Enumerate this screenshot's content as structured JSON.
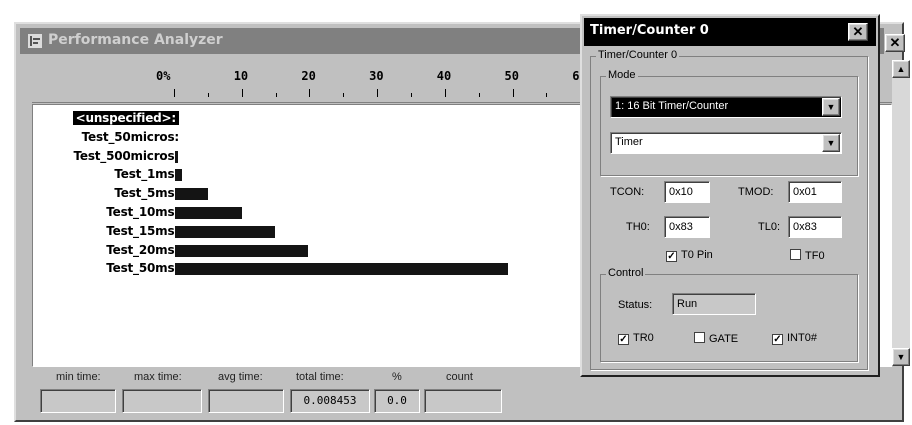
{
  "analyzer": {
    "title": "Performance Analyzer",
    "scale_ticks": [
      "0%",
      "10",
      "20",
      "30",
      "40",
      "50",
      "6"
    ],
    "rows": [
      {
        "label": "<unspecified>:",
        "percent": 0,
        "selected": true
      },
      {
        "label": "Test_50micros:",
        "percent": 0,
        "selected": false
      },
      {
        "label": "Test_500micros:",
        "percent": 0.5,
        "selected": false
      },
      {
        "label": "Test_1ms:",
        "percent": 1,
        "selected": false
      },
      {
        "label": "Test_5ms:",
        "percent": 5,
        "selected": false
      },
      {
        "label": "Test_10ms:",
        "percent": 10,
        "selected": false
      },
      {
        "label": "Test_15ms:",
        "percent": 15,
        "selected": false
      },
      {
        "label": "Test_20ms:",
        "percent": 20,
        "selected": false
      },
      {
        "label": "Test_50ms:",
        "percent": 50,
        "selected": false
      }
    ],
    "stats": {
      "min_time_label": "min time:",
      "max_time_label": "max time:",
      "avg_time_label": "avg time:",
      "total_time_label": "total time:",
      "percent_label": "%",
      "count_label": "count",
      "min_time": "",
      "max_time": "",
      "avg_time": "",
      "total_time": "0.008453",
      "percent": "0.0",
      "count": ""
    }
  },
  "timer_dialog": {
    "title": "Timer/Counter 0",
    "group_label": "Timer/Counter 0",
    "mode_label": "Mode",
    "mode_value": "1: 16 Bit Timer/Counter",
    "type_value": "Timer",
    "tcon_label": "TCON:",
    "tcon_value": "0x10",
    "tmod_label": "TMOD:",
    "tmod_value": "0x01",
    "th0_label": "TH0:",
    "th0_value": "0x83",
    "tl0_label": "TL0:",
    "tl0_value": "0x83",
    "t0pin_label": "T0 Pin",
    "t0pin_checked": true,
    "tf0_label": "TF0",
    "tf0_checked": false,
    "control_label": "Control",
    "status_label": "Status:",
    "status_value": "Run",
    "tr0_label": "TR0",
    "tr0_checked": true,
    "gate_label": "GATE",
    "gate_checked": false,
    "int0_label": "INT0#",
    "int0_checked": true
  },
  "icons": {
    "close": "close-icon",
    "analyzer_window": "chart-window-icon",
    "dropdown": "chevron-down-icon"
  }
}
